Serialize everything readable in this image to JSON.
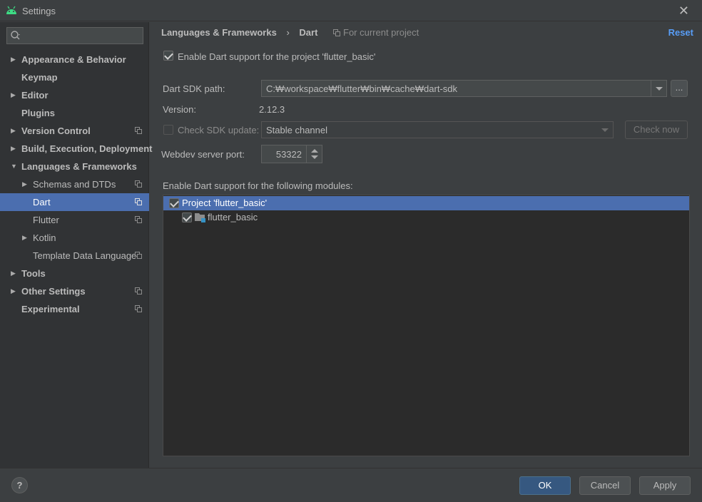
{
  "window": {
    "title": "Settings"
  },
  "search": {
    "placeholder": "",
    "value": ""
  },
  "sidebar": {
    "items": [
      {
        "label": "Appearance & Behavior"
      },
      {
        "label": "Keymap"
      },
      {
        "label": "Editor"
      },
      {
        "label": "Plugins"
      },
      {
        "label": "Version Control"
      },
      {
        "label": "Build, Execution, Deployment"
      },
      {
        "label": "Languages & Frameworks"
      },
      {
        "label": "Schemas and DTDs"
      },
      {
        "label": "Dart"
      },
      {
        "label": "Flutter"
      },
      {
        "label": "Kotlin"
      },
      {
        "label": "Template Data Languages"
      },
      {
        "label": "Tools"
      },
      {
        "label": "Other Settings"
      },
      {
        "label": "Experimental"
      }
    ]
  },
  "header": {
    "crumb1": "Languages & Frameworks",
    "separator": "›",
    "crumb2": "Dart",
    "scope": "For current project",
    "reset": "Reset"
  },
  "form": {
    "enable_label": "Enable Dart support for the project 'flutter_basic'",
    "sdk_path_label": "Dart SDK path:",
    "sdk_path_value": "C:₩workspace₩flutter₩bin₩cache₩dart-sdk",
    "browse_label": "...",
    "version_label": "Version:",
    "version_value": "2.12.3",
    "check_update_label": "Check SDK update:",
    "channel_value": "Stable channel",
    "check_now_label": "Check now",
    "port_label": "Webdev server port:",
    "port_value": "53322",
    "modules_label": "Enable Dart support for the following modules:"
  },
  "modules": {
    "project": "Project 'flutter_basic'",
    "module": "flutter_basic"
  },
  "footer": {
    "help": "?",
    "ok": "OK",
    "cancel": "Cancel",
    "apply": "Apply"
  },
  "colors": {
    "selection": "#4b6eaf",
    "link": "#589df6",
    "primary_button": "#365880"
  }
}
